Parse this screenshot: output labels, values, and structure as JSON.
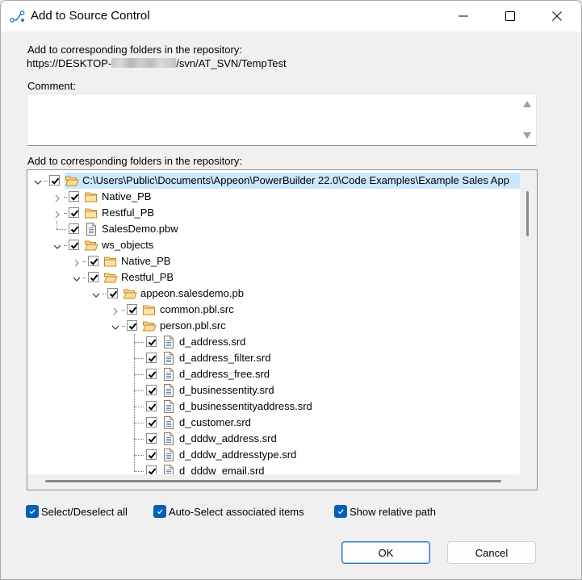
{
  "window": {
    "title": "Add to Source Control",
    "app_icon": "source-control-branch-icon",
    "controls": {
      "minimize": "minimize-icon",
      "maximize": "maximize-icon",
      "close": "close-icon"
    }
  },
  "repository": {
    "label": "Add to corresponding folders in the repository:",
    "url_prefix": "https://DESKTOP-",
    "url_suffix": "/svn/AT_SVN/TempTest",
    "url_redacted": true
  },
  "comment": {
    "label": "Comment:",
    "value": "",
    "placeholder": ""
  },
  "tree": {
    "label": "Add to corresponding folders in the repository:",
    "nodes": [
      {
        "label": "C:\\Users\\Public\\Documents\\Appeon\\PowerBuilder 22.0\\Code Examples\\Example Sales App",
        "level": 0,
        "type": "folder-open",
        "expander": "expanded",
        "checked": true,
        "selected": true
      },
      {
        "label": "Native_PB",
        "level": 1,
        "type": "folder",
        "expander": "collapsed",
        "checked": true
      },
      {
        "label": "Restful_PB",
        "level": 1,
        "type": "folder",
        "expander": "collapsed",
        "checked": true
      },
      {
        "label": "SalesDemo.pbw",
        "level": 1,
        "type": "file",
        "expander": "none",
        "checked": true
      },
      {
        "label": "ws_objects",
        "level": 1,
        "type": "folder-open",
        "expander": "expanded",
        "checked": true
      },
      {
        "label": "Native_PB",
        "level": 2,
        "type": "folder",
        "expander": "collapsed",
        "checked": true
      },
      {
        "label": "Restful_PB",
        "level": 2,
        "type": "folder-open",
        "expander": "expanded",
        "checked": true
      },
      {
        "label": "appeon.salesdemo.pb",
        "level": 3,
        "type": "folder-open",
        "expander": "expanded",
        "checked": true
      },
      {
        "label": "common.pbl.src",
        "level": 4,
        "type": "folder",
        "expander": "collapsed",
        "checked": true
      },
      {
        "label": "person.pbl.src",
        "level": 4,
        "type": "folder-open",
        "expander": "expanded",
        "checked": true
      },
      {
        "label": "d_address.srd",
        "level": 5,
        "type": "file",
        "expander": "none",
        "checked": true
      },
      {
        "label": "d_address_filter.srd",
        "level": 5,
        "type": "file",
        "expander": "none",
        "checked": true
      },
      {
        "label": "d_address_free.srd",
        "level": 5,
        "type": "file",
        "expander": "none",
        "checked": true
      },
      {
        "label": "d_businessentity.srd",
        "level": 5,
        "type": "file",
        "expander": "none",
        "checked": true
      },
      {
        "label": "d_businessentityaddress.srd",
        "level": 5,
        "type": "file",
        "expander": "none",
        "checked": true
      },
      {
        "label": "d_customer.srd",
        "level": 5,
        "type": "file",
        "expander": "none",
        "checked": true
      },
      {
        "label": "d_dddw_address.srd",
        "level": 5,
        "type": "file",
        "expander": "none",
        "checked": true
      },
      {
        "label": "d_dddw_addresstype.srd",
        "level": 5,
        "type": "file",
        "expander": "none",
        "checked": true
      },
      {
        "label": "d_dddw_email.srd",
        "level": 5,
        "type": "file",
        "expander": "none",
        "checked": true
      }
    ]
  },
  "options": [
    {
      "label": "Select/Deselect all",
      "checked": true
    },
    {
      "label": "Auto-Select associated items",
      "checked": true
    },
    {
      "label": "Show relative path",
      "checked": true
    }
  ],
  "buttons": {
    "ok": "OK",
    "cancel": "Cancel"
  },
  "colors": {
    "accent": "#005fb8",
    "selection": "#cce8ff",
    "folder": "#e8b04a",
    "dialog_bg": "#f0f0f0"
  }
}
